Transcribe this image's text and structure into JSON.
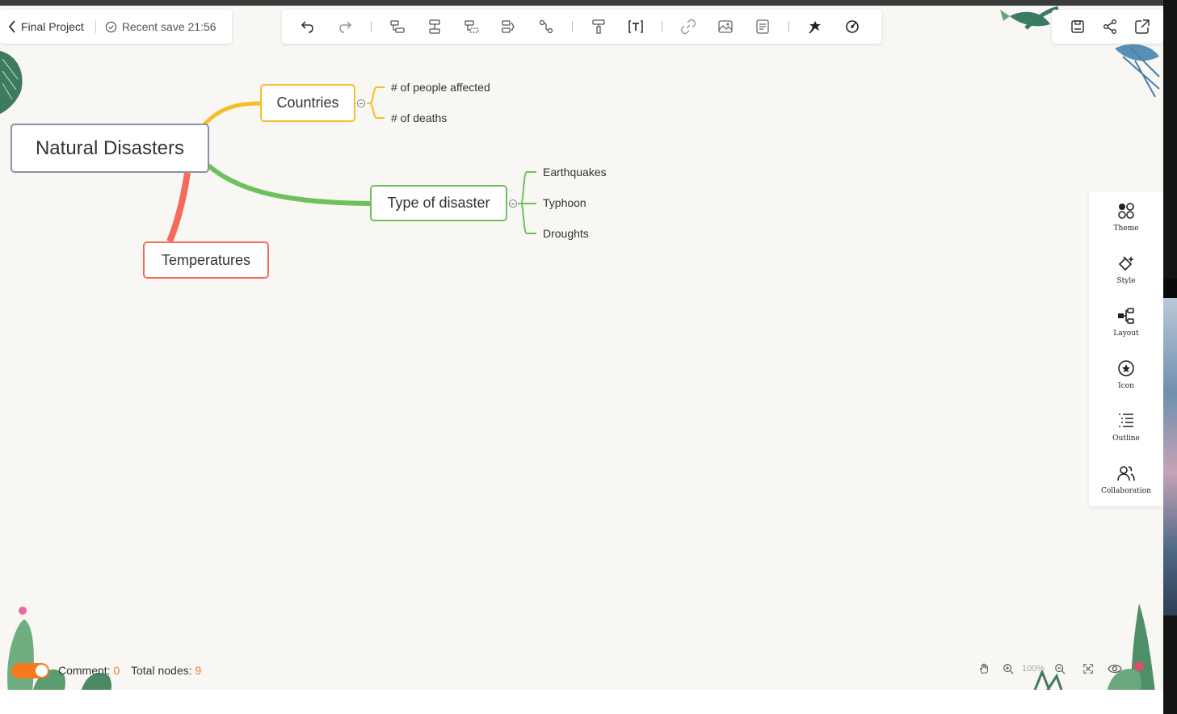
{
  "header": {
    "title": "Final Project",
    "save_status": "Recent save 21:56"
  },
  "toolbar": {
    "items": [
      "undo-icon",
      "redo-icon",
      "add-subtopic-icon",
      "add-sibling-icon",
      "add-parent-icon",
      "add-summary-icon",
      "relationship-icon",
      "format-painter-icon",
      "text-style-icon",
      "link-icon",
      "image-icon",
      "note-icon",
      "sticker-icon",
      "explore-icon"
    ]
  },
  "actions": {
    "items": [
      "save-icon",
      "share-icon",
      "export-icon"
    ]
  },
  "mindmap": {
    "root": "Natural Disasters",
    "branches": [
      {
        "label": "Countries",
        "color": "#f5bf2a",
        "children": [
          "# of people affected",
          "# of deaths"
        ]
      },
      {
        "label": "Type of disaster",
        "color": "#6cc15c",
        "children": [
          "Earthquakes",
          "Typhoon",
          "Droughts"
        ]
      },
      {
        "label": "Temperatures",
        "color": "#f46b5c",
        "children": []
      }
    ]
  },
  "sidepanel": {
    "items": [
      {
        "label": "Theme",
        "icon": "theme-icon"
      },
      {
        "label": "Style",
        "icon": "style-icon"
      },
      {
        "label": "Layout",
        "icon": "layout-icon"
      },
      {
        "label": "Icon",
        "icon": "icon-icon"
      },
      {
        "label": "Outline",
        "icon": "outline-icon"
      },
      {
        "label": "Collaboration",
        "icon": "collaboration-icon"
      }
    ]
  },
  "status": {
    "comment_label": "Comment:",
    "comment_count": "0",
    "nodes_label": "Total nodes:",
    "nodes_count": "9",
    "zoom": "100%"
  },
  "colors": {
    "accent": "#f5791f",
    "canvas": "#f8f7f4",
    "root_border": "#8b8fa8"
  }
}
